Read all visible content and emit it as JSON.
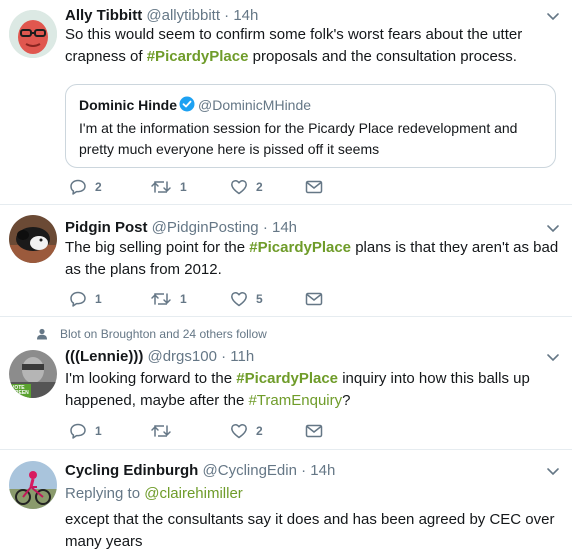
{
  "tweets": [
    {
      "name": "Ally Tibbitt",
      "handle": "@allytibbitt",
      "dot": "·",
      "time": "14h",
      "text_parts": [
        "So this would seem to confirm some folk's worst fears about the utter crapness of ",
        "#PicardyPlace",
        " proposals and the consultation process."
      ],
      "quote": {
        "name": "Dominic Hinde",
        "handle": "@DominicMHinde",
        "text": "I'm at the information session for the Picardy Place redevelopment and pretty much everyone here is pissed off it seems"
      },
      "replies": "2",
      "retweets": "1",
      "likes": "2"
    },
    {
      "name": "Pidgin Post",
      "handle": "@PidginPosting",
      "dot": "·",
      "time": "14h",
      "text_parts": [
        "The big selling point for the ",
        "#PicardyPlace",
        " plans is that they aren't as bad as the plans from 2012."
      ],
      "replies": "1",
      "retweets": "1",
      "likes": "5"
    },
    {
      "follow_note": "Blot on Broughton and 24 others follow",
      "name": "(((Lennie)))",
      "handle": "@drgs100",
      "dot": "·",
      "time": "11h",
      "text_parts": [
        "I'm looking forward to the ",
        "#PicardyPlace",
        " inquiry into how this balls up happened, maybe after the ",
        "#TramEnquiry",
        "?"
      ],
      "avatar_badge": "VOTE GREEN",
      "replies": "1",
      "retweets": "",
      "likes": "2"
    },
    {
      "name": "Cycling Edinburgh",
      "handle": "@CyclingEdin",
      "dot": "·",
      "time": "14h",
      "replying_label": "Replying to ",
      "replying_to": "@clairehimiller",
      "text": "except that the consultants say it does and has been agreed by CEC over many years"
    }
  ],
  "colors": {
    "hashtag": "#6f9c2a",
    "secondary": "#657786",
    "divider": "#e6ecf0",
    "verified": "#1da1f2"
  }
}
